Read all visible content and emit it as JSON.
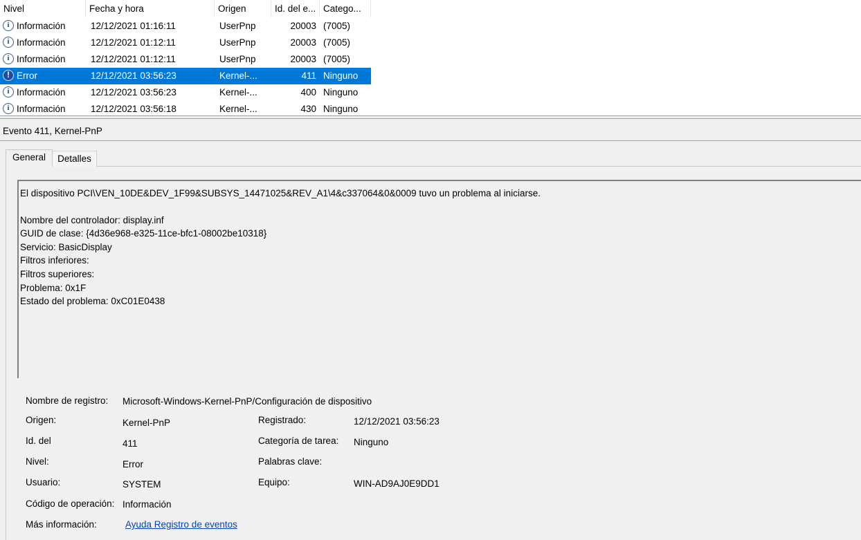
{
  "columns": {
    "level": "Nivel",
    "date": "Fecha y hora",
    "source": "Origen",
    "id": "Id. del e...",
    "category": "Catego..."
  },
  "rows": [
    {
      "level": "Información",
      "date": "12/12/2021 01:16:11",
      "source": "UserPnp",
      "id": "20003",
      "category": "(7005)",
      "icon": "info-icon"
    },
    {
      "level": "Información",
      "date": "12/12/2021 01:12:11",
      "source": "UserPnp",
      "id": "20003",
      "category": "(7005)",
      "icon": "info-icon"
    },
    {
      "level": "Información",
      "date": "12/12/2021 01:12:11",
      "source": "UserPnp",
      "id": "20003",
      "category": "(7005)",
      "icon": "info-icon"
    },
    {
      "level": "Error",
      "date": "12/12/2021 03:56:23",
      "source": "Kernel-...",
      "id": "411",
      "category": "Ninguno",
      "icon": "error-icon",
      "selected": true
    },
    {
      "level": "Información",
      "date": "12/12/2021 03:56:23",
      "source": "Kernel-...",
      "id": "400",
      "category": "Ninguno",
      "icon": "info-icon"
    },
    {
      "level": "Información",
      "date": "12/12/2021 03:56:18",
      "source": "Kernel-...",
      "id": "430",
      "category": "Ninguno",
      "icon": "info-icon"
    }
  ],
  "details": {
    "title": "Evento 411, Kernel-PnP",
    "tabs": {
      "general": "General",
      "details": "Detalles"
    },
    "description": {
      "line1": "El dispositivo PCI\\VEN_10DE&DEV_1F99&SUBSYS_14471025&REV_A1\\4&c337064&0&0009 tuvo un problema al iniciarse.",
      "driver": "Nombre del controlador: display.inf",
      "guid": "GUID de clase: {4d36e968-e325-11ce-bfc1-08002be10318}",
      "service": "Servicio: BasicDisplay",
      "lower_filters": "Filtros inferiores:",
      "upper_filters": "Filtros superiores:",
      "problem": "Problema: 0x1F",
      "problem_status": "Estado del problema: 0xC01E0438"
    },
    "props": {
      "log_name_label": "Nombre de registro:",
      "log_name": "Microsoft-Windows-Kernel-PnP/Configuración de dispositivo",
      "source_label": "Origen:",
      "source": "Kernel-PnP",
      "logged_label": "Registrado:",
      "logged": "12/12/2021 03:56:23",
      "event_id_label": "Id. del",
      "event_id": "411",
      "task_category_label": "Categoría de tarea:",
      "task_category": "Ninguno",
      "level_label": "Nivel:",
      "level": "Error",
      "keywords_label": "Palabras clave:",
      "user_label": "Usuario:",
      "user": "SYSTEM",
      "computer_label": "Equipo:",
      "computer": "WIN-AD9AJ0E9DD1",
      "opcode_label": "Código de operación:",
      "opcode": "Información",
      "more_info_label": "Más información:",
      "more_info_link": "Ayuda Registro de eventos"
    }
  },
  "colors": {
    "selection": "#0078d7",
    "link": "#0645ad",
    "info_icon": "#1f4e8c",
    "error_icon": "#1e4ea0"
  }
}
